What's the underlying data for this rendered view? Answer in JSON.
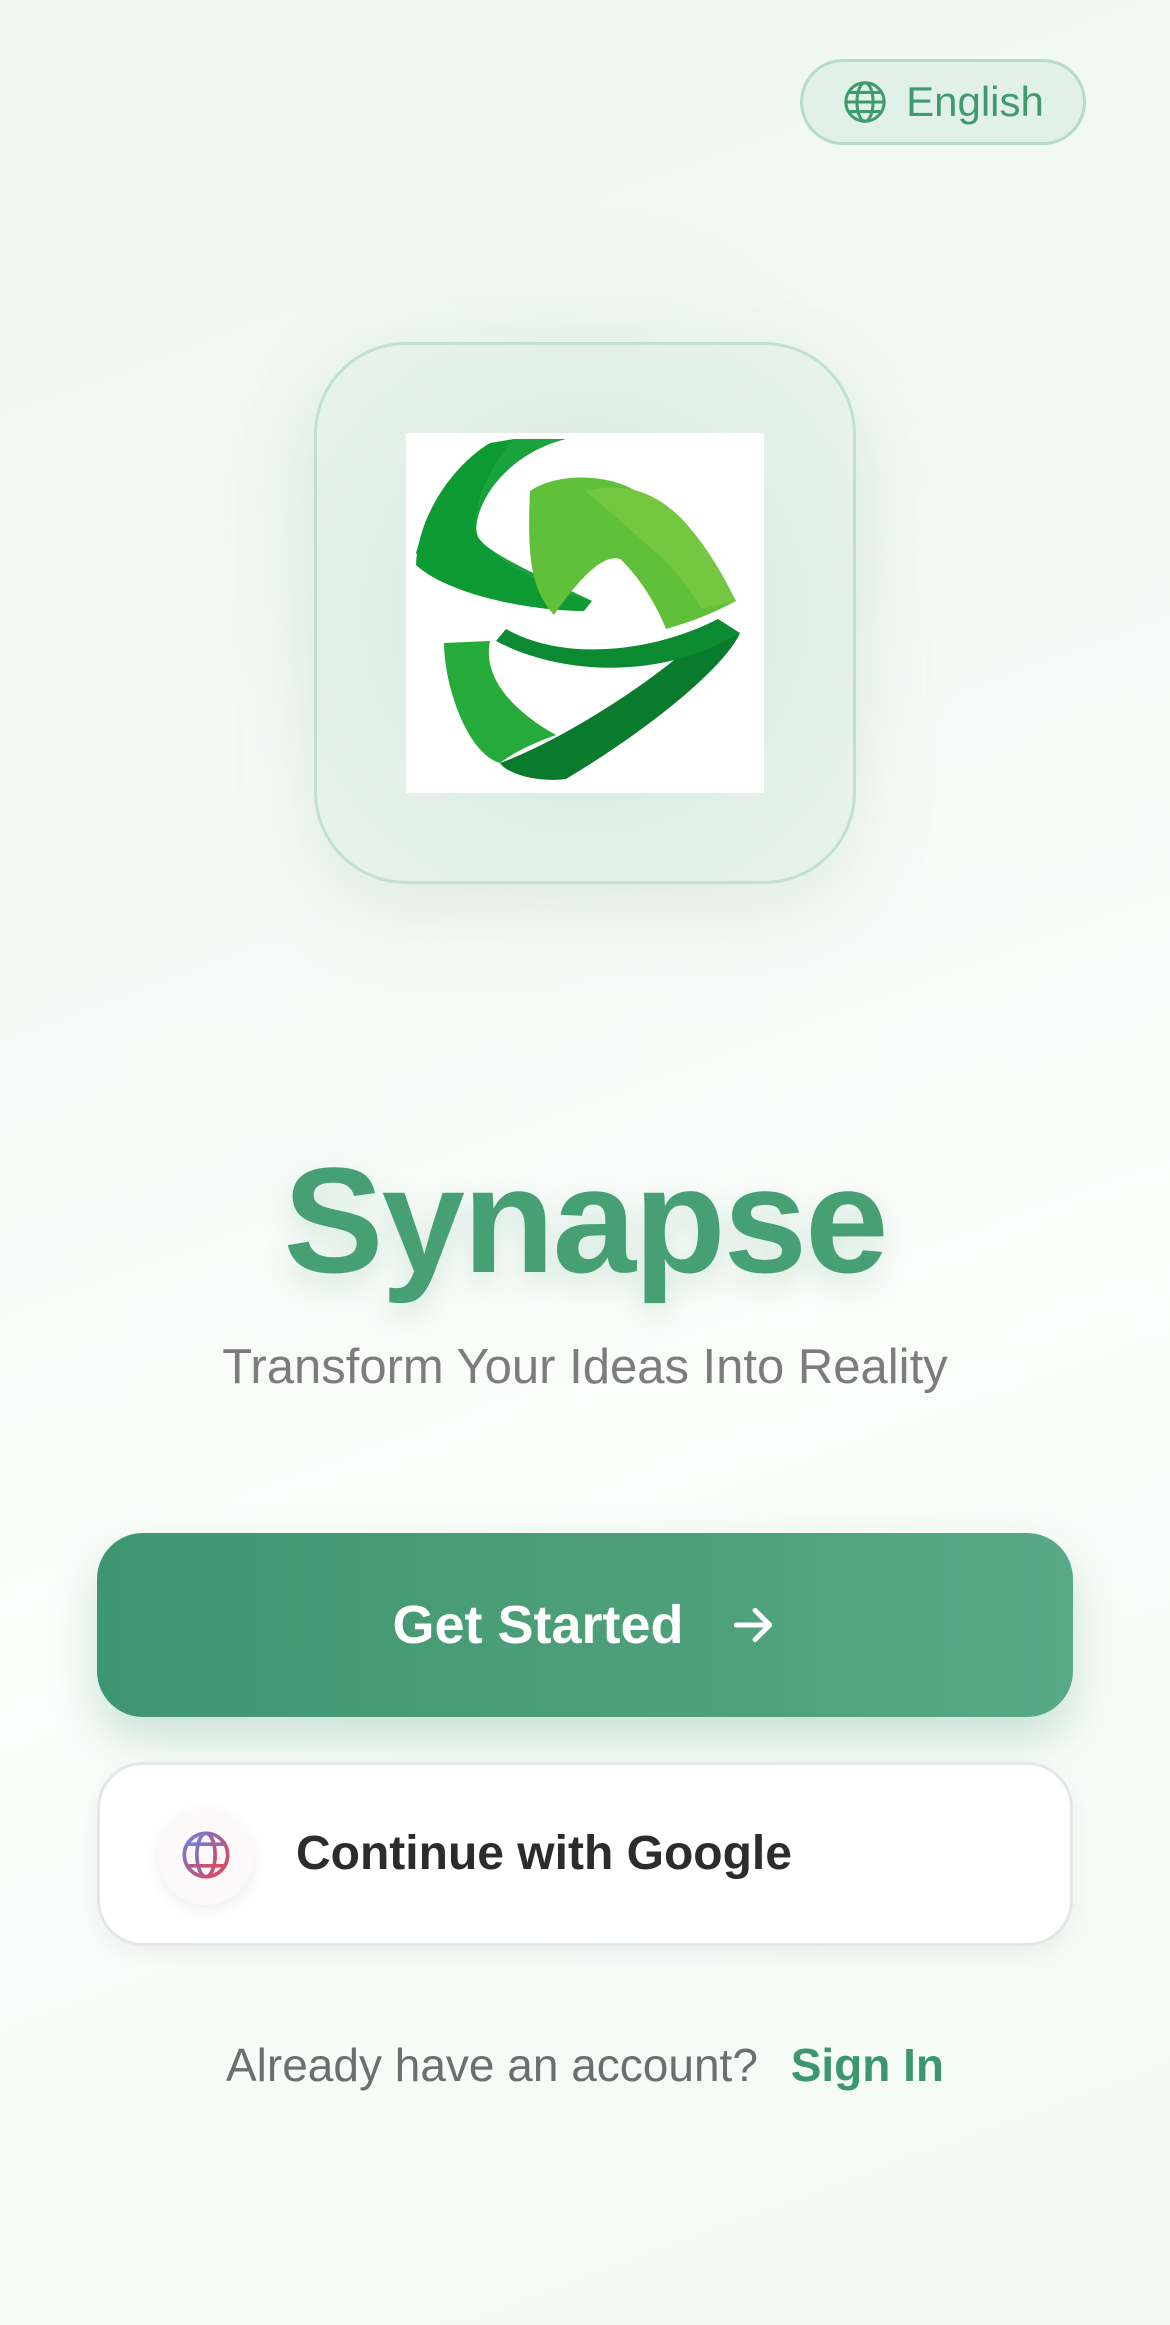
{
  "header": {
    "language_label": "English",
    "language_icon": "globe-icon"
  },
  "brand": {
    "logo": "synapse-logo",
    "title": "Synapse",
    "tagline": "Transform Your Ideas Into Reality"
  },
  "actions": {
    "get_started_label": "Get Started",
    "get_started_icon": "arrow-right-icon",
    "google_label": "Continue with Google",
    "google_icon": "globe-icon"
  },
  "footer": {
    "prompt": "Already have an account?",
    "sign_in_label": "Sign In"
  },
  "colors": {
    "accent": "#47a074",
    "button": "#3e9670",
    "background": "#f4faf6"
  }
}
